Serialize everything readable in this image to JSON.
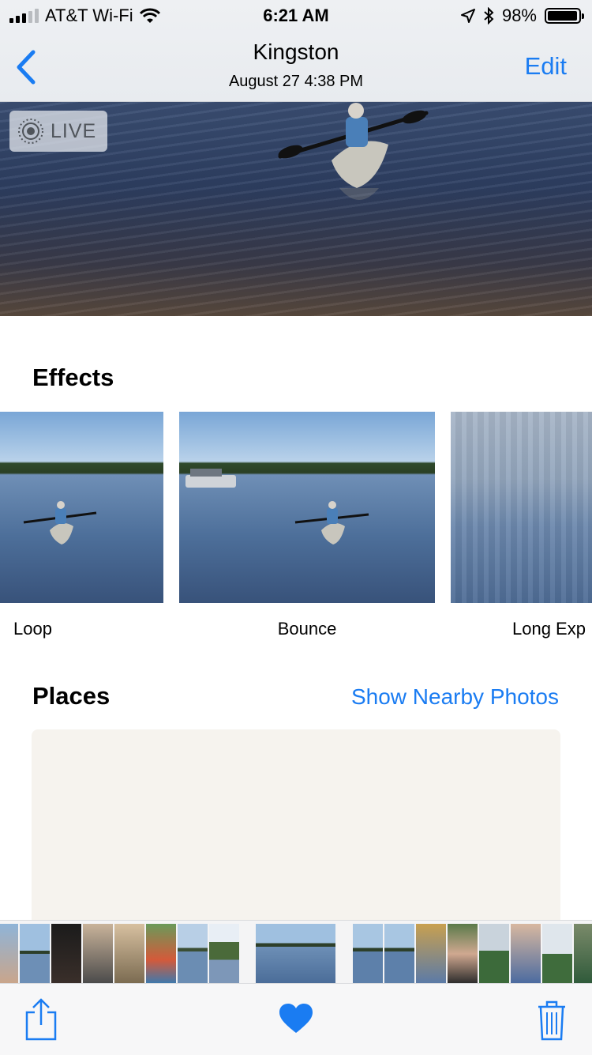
{
  "status_bar": {
    "carrier": "AT&T Wi-Fi",
    "time": "6:21 AM",
    "battery": "98%",
    "battery_level": 0.98,
    "icons": [
      "signal-icon",
      "wifi-icon",
      "location-icon",
      "bluetooth-icon",
      "battery-icon"
    ]
  },
  "nav": {
    "title": "Kingston",
    "subtitle": "August 27  4:38 PM",
    "edit_label": "Edit"
  },
  "photo": {
    "live_label": "LIVE"
  },
  "effects": {
    "title": "Effects",
    "items": [
      {
        "label": "Loop"
      },
      {
        "label": "Bounce"
      },
      {
        "label": "Long Exp"
      }
    ]
  },
  "places": {
    "title": "Places",
    "link_label": "Show Nearby Photos"
  },
  "toolbar": {
    "icons": [
      "share-icon",
      "heart-icon",
      "trash-icon"
    ],
    "accent": "#1a7cf2"
  },
  "colors": {
    "accent": "#1a7cf2",
    "map_bg": "#f6f3ee"
  }
}
